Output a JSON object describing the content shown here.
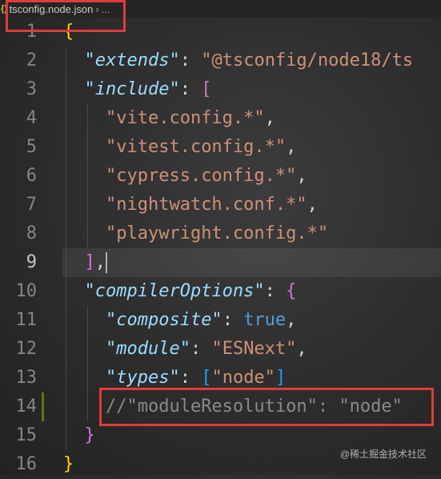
{
  "breadcrumb": {
    "file_icon": "{}",
    "filename": "tsconfig.node.json",
    "separator": "›",
    "more": "..."
  },
  "lines": [
    {
      "n": "1"
    },
    {
      "n": "2"
    },
    {
      "n": "3"
    },
    {
      "n": "4"
    },
    {
      "n": "5"
    },
    {
      "n": "6"
    },
    {
      "n": "7"
    },
    {
      "n": "8"
    },
    {
      "n": "9"
    },
    {
      "n": "10"
    },
    {
      "n": "11"
    },
    {
      "n": "12"
    },
    {
      "n": "13"
    },
    {
      "n": "14"
    },
    {
      "n": "15"
    },
    {
      "n": "16"
    }
  ],
  "code": {
    "l1_open": "{",
    "l2_key": "\"extends\"",
    "l2_colon": ": ",
    "l2_val": "\"@tsconfig/node18/ts",
    "l3_key": "\"include\"",
    "l3_colon": ": ",
    "l3_open": "[",
    "l4": "\"vite.config.*\"",
    "l5": "\"vitest.config.*\"",
    "l6": "\"cypress.config.*\"",
    "l7": "\"nightwatch.conf.*\"",
    "l8": "\"playwright.config.*\"",
    "l9_close": "]",
    "l9_comma": ",",
    "l10_key": "\"compilerOptions\"",
    "l10_colon": ": ",
    "l10_open": "{",
    "l11_key": "\"composite\"",
    "l11_colon": ": ",
    "l11_val": "true",
    "l12_key": "\"module\"",
    "l12_colon": ": ",
    "l12_val": "\"ESNext\"",
    "l13_key": "\"types\"",
    "l13_colon": ": ",
    "l13_open": "[",
    "l13_val": "\"node\"",
    "l13_close": "]",
    "l14_comment": "//\"moduleResolution\": \"node\"",
    "l15_close": "}",
    "l16_close": "}",
    "comma": ","
  },
  "watermark": "@稀土掘金技术社区",
  "colors": {
    "key": "#9cdcfe",
    "string": "#ce9178",
    "bracket_level1": "#ffd700",
    "bracket_level2": "#da70d6",
    "bracket_level3": "#179fff",
    "keyword": "#569cd6",
    "comment": "#8a8a8a",
    "highlight_box": "#e03b3b"
  }
}
